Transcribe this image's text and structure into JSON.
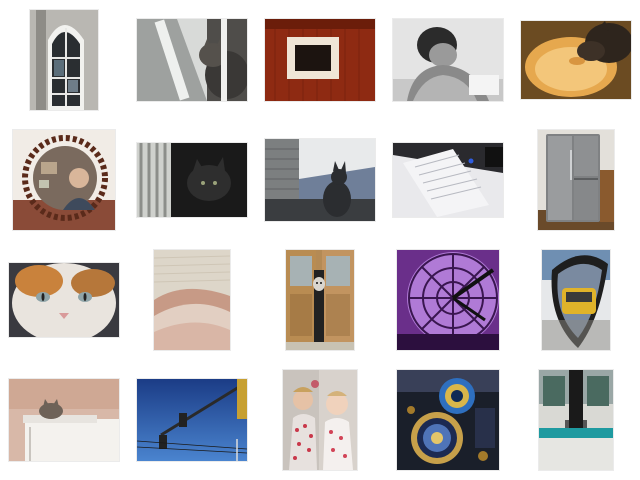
{
  "gallery": {
    "rows": 4,
    "columns": 5,
    "background": "#ffffff",
    "thumbnails": [
      {
        "subject": "arched-window"
      },
      {
        "subject": "cat-at-window"
      },
      {
        "subject": "framed-picture-on-red-wall"
      },
      {
        "subject": "child-bw"
      },
      {
        "subject": "cat-drinking-from-sink"
      },
      {
        "subject": "person-in-round-mirror"
      },
      {
        "subject": "dark-cat-window"
      },
      {
        "subject": "cat-silhouette-window"
      },
      {
        "subject": "keyboard-desk"
      },
      {
        "subject": "refrigerator"
      },
      {
        "subject": "cat-face-closeup"
      },
      {
        "subject": "fur-closeup"
      },
      {
        "subject": "cat-peeking-doors"
      },
      {
        "subject": "purple-clock-face"
      },
      {
        "subject": "bus-in-mirror"
      },
      {
        "subject": "cat-on-shelf"
      },
      {
        "subject": "traffic-light-blue-sky"
      },
      {
        "subject": "children-mirror"
      },
      {
        "subject": "astronomical-clock"
      },
      {
        "subject": "train-doors"
      }
    ]
  }
}
